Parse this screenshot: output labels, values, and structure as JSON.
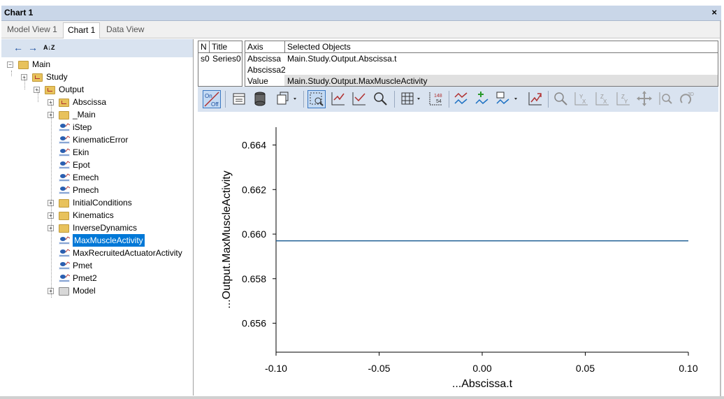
{
  "window": {
    "title": "Chart 1",
    "close_glyph": "×"
  },
  "tabs": [
    {
      "label": "Model View 1",
      "active": false
    },
    {
      "label": "Chart 1",
      "active": true
    },
    {
      "label": "Data View",
      "active": false
    }
  ],
  "tree_toolbar": {
    "back_icon": "arrow-left-icon",
    "forward_icon": "arrow-right-icon",
    "sort_icon": "sort-az-icon",
    "back_glyph": "←",
    "forward_glyph": "→",
    "sort_glyph": "A↓Z"
  },
  "tree": {
    "main": "Main",
    "study": "Study",
    "output": "Output",
    "items": [
      {
        "label": "Abscissa",
        "kind": "folder-study",
        "expandable": true
      },
      {
        "label": "_Main",
        "kind": "folder",
        "expandable": true
      },
      {
        "label": "iStep",
        "kind": "float",
        "expandable": false
      },
      {
        "label": "KinematicError",
        "kind": "float",
        "expandable": false
      },
      {
        "label": "Ekin",
        "kind": "float",
        "expandable": false
      },
      {
        "label": "Epot",
        "kind": "float",
        "expandable": false
      },
      {
        "label": "Emech",
        "kind": "float",
        "expandable": false
      },
      {
        "label": "Pmech",
        "kind": "float",
        "expandable": false
      },
      {
        "label": "InitialConditions",
        "kind": "folder",
        "expandable": true
      },
      {
        "label": "Kinematics",
        "kind": "folder",
        "expandable": true
      },
      {
        "label": "InverseDynamics",
        "kind": "folder",
        "expandable": true
      },
      {
        "label": "MaxMuscleActivity",
        "kind": "float",
        "expandable": false,
        "selected": true
      },
      {
        "label": "MaxRecruitedActuatorActivity",
        "kind": "float",
        "expandable": false
      },
      {
        "label": "Pmet",
        "kind": "float",
        "expandable": false
      },
      {
        "label": "Pmet2",
        "kind": "float",
        "expandable": false
      },
      {
        "label": "Model",
        "kind": "model",
        "expandable": true
      }
    ]
  },
  "series_table": {
    "headers": [
      "N",
      "Title"
    ],
    "rows": [
      [
        "s0",
        "Series0"
      ]
    ]
  },
  "axis_table": {
    "headers": [
      "Axis",
      "Selected Objects"
    ],
    "rows": [
      [
        "Abscissa",
        "Main.Study.Output.Abscissa.t"
      ],
      [
        "Abscissa2",
        ""
      ],
      [
        "Value",
        "Main.Study.Output.MaxMuscleActivity"
      ]
    ]
  },
  "chart_toolbar": {
    "onoff_label_on": "On",
    "onoff_label_off": "Off",
    "points_label_top": "148",
    "points_label_bottom": "54",
    "three_d_label": "3D",
    "y_letter": "Y",
    "x_letter": "X",
    "z_letter": "Z"
  },
  "chart_data": {
    "type": "line",
    "xlabel": "...Abscissa.t",
    "ylabel": "...Output.MaxMuscleActivity",
    "xlim": [
      -0.1,
      0.1
    ],
    "ylim": [
      0.6547,
      0.6648
    ],
    "xticks": [
      -0.1,
      -0.05,
      0.0,
      0.05,
      0.1
    ],
    "xtick_labels": [
      "-0.10",
      "-0.05",
      "0.00",
      "0.05",
      "0.10"
    ],
    "yticks": [
      0.656,
      0.658,
      0.66,
      0.662,
      0.664
    ],
    "ytick_labels": [
      "0.656",
      "0.658",
      "0.660",
      "0.662",
      "0.664"
    ],
    "series": [
      {
        "x": [
          -0.1,
          0.1
        ],
        "y": [
          0.6597,
          0.6597
        ],
        "color": "#1f5f94"
      }
    ]
  }
}
